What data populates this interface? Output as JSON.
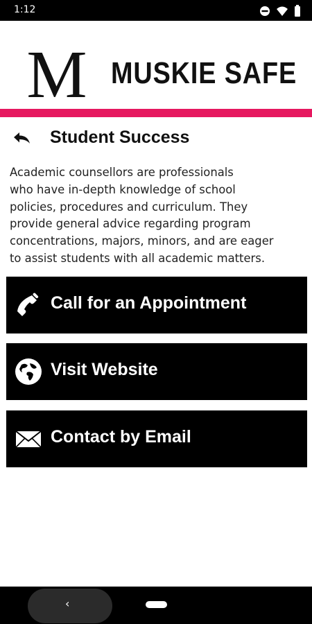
{
  "status_bar": {
    "time": "1:12",
    "icons": [
      "do-not-disturb-icon",
      "wifi-icon",
      "battery-icon"
    ]
  },
  "header": {
    "logo_letter": "M",
    "app_title": "MUSKIE SAFE"
  },
  "colors": {
    "accent": "#e6185f",
    "button_bg": "#000000",
    "button_text": "#ffffff"
  },
  "page": {
    "back_icon": "back-arrow-icon",
    "title": "Student Success",
    "description_lines": [
      "Academic counsellors are professionals",
      "who have in-depth knowledge of school",
      "policies, procedures and curriculum. They",
      "provide general advice regarding program",
      "concentrations, majors, minors, and are eager",
      "to assist students with all academic matters."
    ]
  },
  "actions": [
    {
      "icon": "phone-icon",
      "label": "Call for an Appointment"
    },
    {
      "icon": "globe-icon",
      "label": "Visit Website"
    },
    {
      "icon": "mail-icon",
      "label": "Contact by Email"
    }
  ],
  "nav_bar": {
    "back_glyph": "‹"
  }
}
